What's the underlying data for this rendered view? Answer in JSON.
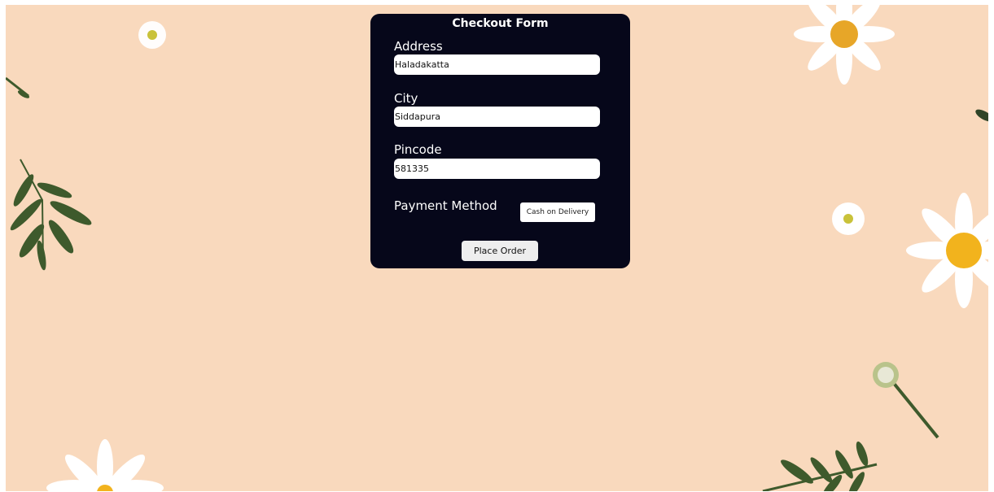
{
  "form": {
    "title": "Checkout Form",
    "address": {
      "label": "Address",
      "value": "Haladakatta"
    },
    "city": {
      "label": "City",
      "value": "Siddapura"
    },
    "pincode": {
      "label": "Pincode",
      "value": "581335"
    },
    "payment": {
      "label": "Payment Method",
      "selected": "Cash on Delivery"
    },
    "submit_label": "Place Order"
  },
  "colors": {
    "background": "#f9d9bd",
    "panel": "#06071a",
    "daisy_petal": "#ffffff",
    "daisy_center": "#f2b31d",
    "leaf": "#3e5a2c"
  }
}
